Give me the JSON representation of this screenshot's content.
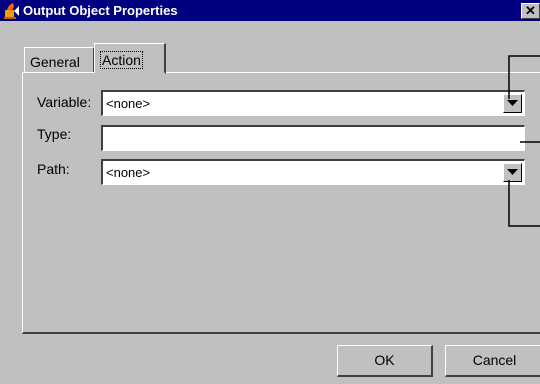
{
  "window": {
    "title": "Output Object Properties",
    "close_glyph": "✕",
    "icon": "java-cup-icon"
  },
  "tabs": [
    {
      "label": "General",
      "selected": false
    },
    {
      "label": "Action",
      "selected": true
    }
  ],
  "fields": {
    "variable": {
      "label": "Variable:",
      "value": "<none>"
    },
    "type": {
      "label": "Type:",
      "value": ""
    },
    "path": {
      "label": "Path:",
      "value": "<none>"
    }
  },
  "buttons": {
    "ok": "OK",
    "cancel": "Cancel"
  },
  "colors": {
    "titlebar": "#000080",
    "face": "#c0c0c0",
    "field": "#ffffff"
  }
}
